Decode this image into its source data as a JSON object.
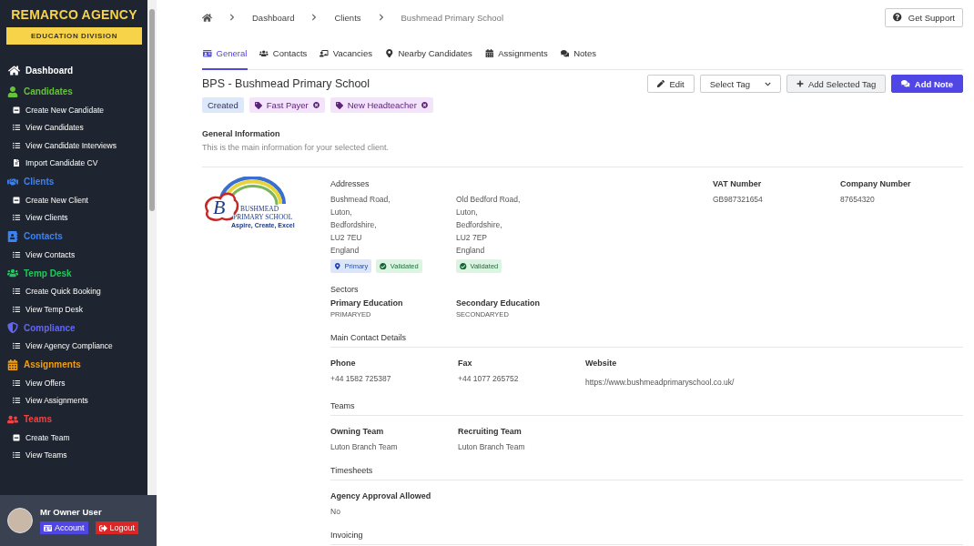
{
  "brand": {
    "name": "REMARCO AGENCY",
    "division": "EDUCATION DIVISION"
  },
  "sidebar": {
    "home": {
      "label": "Dashboard"
    },
    "sections": [
      {
        "label": "Candidates",
        "color": "#65c23a",
        "items": [
          {
            "label": "Create New Candidate",
            "kind": "create"
          },
          {
            "label": "View Candidates",
            "kind": "list"
          },
          {
            "label": "View Candidate Interviews",
            "kind": "list"
          },
          {
            "label": "Import Candidate CV",
            "kind": "file"
          }
        ]
      },
      {
        "label": "Clients",
        "color": "#3b82f6",
        "items": [
          {
            "label": "Create New Client",
            "kind": "create"
          },
          {
            "label": "View Clients",
            "kind": "list"
          }
        ]
      },
      {
        "label": "Contacts",
        "color": "#3b82f6",
        "items": [
          {
            "label": "View Contacts",
            "kind": "list"
          }
        ]
      },
      {
        "label": "Temp Desk",
        "color": "#22c55e",
        "items": [
          {
            "label": "Create Quick Booking",
            "kind": "list"
          },
          {
            "label": "View Temp Desk",
            "kind": "list"
          }
        ]
      },
      {
        "label": "Compliance",
        "color": "#6366f1",
        "items": [
          {
            "label": "View Agency Compliance",
            "kind": "list"
          }
        ]
      },
      {
        "label": "Assignments",
        "color": "#f59e0b",
        "items": [
          {
            "label": "View Offers",
            "kind": "list"
          },
          {
            "label": "View Assignments",
            "kind": "list"
          }
        ]
      },
      {
        "label": "Teams",
        "color": "#ef4444",
        "items": [
          {
            "label": "Create Team",
            "kind": "create"
          },
          {
            "label": "View Teams",
            "kind": "list"
          }
        ]
      }
    ]
  },
  "user": {
    "name": "Mr Owner User",
    "buttons": [
      {
        "label": "Account",
        "kind": "account"
      },
      {
        "label": "Logout",
        "kind": "logout"
      }
    ]
  },
  "breadcrumb": [
    {
      "label": "Dashboard",
      "current": false
    },
    {
      "label": "Clients",
      "current": false
    },
    {
      "label": "Bushmead Primary School",
      "current": true
    }
  ],
  "support_button": "Get Support",
  "tabs": [
    {
      "label": "General",
      "selected": true
    },
    {
      "label": "Contacts",
      "selected": false
    },
    {
      "label": "Vacancies",
      "selected": false
    },
    {
      "label": "Nearby Candidates",
      "selected": false
    },
    {
      "label": "Assignments",
      "selected": false
    },
    {
      "label": "Notes",
      "selected": false
    }
  ],
  "title": "BPS - Bushmead Primary School",
  "actions": {
    "edit": "Edit",
    "select_tag": "Select Tag",
    "add_tag": "Add Selected Tag",
    "add_note": "Add Note"
  },
  "tags": [
    {
      "label": "Created",
      "kind": "status"
    },
    {
      "label": "Fast Payer",
      "kind": "tag"
    },
    {
      "label": "New Headteacher",
      "kind": "tag"
    }
  ],
  "general": {
    "heading": "General Information",
    "description": "This is the main information for your selected client."
  },
  "logo": {
    "initial": "B",
    "line_1": "BUSHMEAD",
    "line_2": "PRIMARY SCHOOL",
    "motto": "Aspire, Create, Excel"
  },
  "addresses": {
    "label": "Addresses",
    "items": [
      {
        "lines": [
          "Bushmead Road,",
          "Luton,",
          "Bedfordshire,",
          "LU2 7EU",
          "England"
        ],
        "badges": [
          {
            "label": "Primary",
            "kind": "primary"
          },
          {
            "label": "Validated",
            "kind": "validated"
          }
        ]
      },
      {
        "lines": [
          "Old Bedford Road,",
          "Luton,",
          "Bedfordshire,",
          "LU2 7EP",
          "England"
        ],
        "badges": [
          {
            "label": "Validated",
            "kind": "validated"
          }
        ]
      }
    ]
  },
  "vat": {
    "label": "VAT Number",
    "value": "GB987321654"
  },
  "company": {
    "label": "Company Number",
    "value": "87654320"
  },
  "sectors": {
    "label": "Sectors",
    "items": [
      {
        "name": "Primary Education",
        "code": "PRIMARYED"
      },
      {
        "name": "Secondary Education",
        "code": "SECONDARYED"
      }
    ]
  },
  "sections": [
    {
      "heading": "Main Contact Details",
      "fields": [
        {
          "label": "Phone",
          "value": "+44 1582 725387",
          "kind": "text"
        },
        {
          "label": "Fax",
          "value": "+44 1077 265752",
          "kind": "text"
        },
        {
          "label": "Website",
          "value": "https://www.bushmeadprimaryschool.co.uk/",
          "kind": "link"
        }
      ]
    },
    {
      "heading": "Teams",
      "fields": [
        {
          "label": "Owning Team",
          "value": "Luton Branch Team",
          "kind": "text"
        },
        {
          "label": "Recruiting Team",
          "value": "Luton Branch Team",
          "kind": "text"
        }
      ]
    },
    {
      "heading": "Timesheets",
      "fields": [
        {
          "label": "Agency Approval Allowed",
          "value": "No",
          "kind": "text"
        }
      ]
    },
    {
      "heading": "Invoicing"
    }
  ]
}
